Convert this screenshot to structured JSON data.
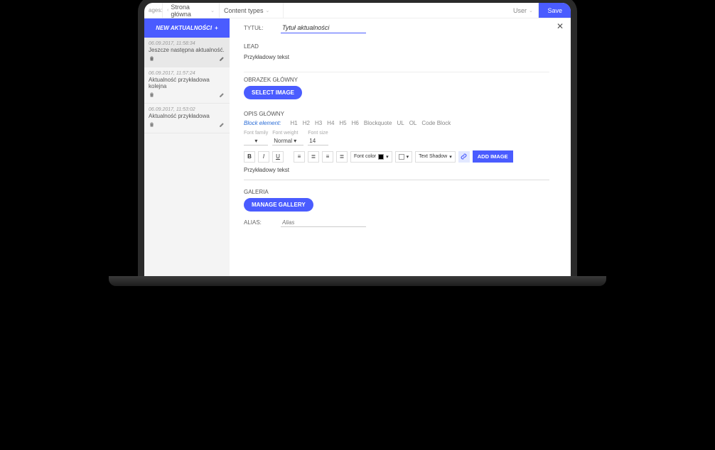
{
  "topbar": {
    "pages_label": "ages:",
    "home_label": "Strona główna",
    "types_label": "Content types",
    "user_label": "User",
    "save_label": "Save"
  },
  "sidebar": {
    "new_button": "NEW AKTUALNOŚCI",
    "items": [
      {
        "date": "06.09.2017, 11:58:34",
        "title": "Jeszcze następna aktualność."
      },
      {
        "date": "06.09.2017, 11:57:24",
        "title": "Aktualność przykładowa kolejna"
      },
      {
        "date": "06.09.2017, 11:53:02",
        "title": "Aktualność przykładowa"
      }
    ]
  },
  "form": {
    "title_label": "TYTUŁ:",
    "title_value": "Tytuł aktualności",
    "lead_label": "LEAD",
    "lead_text": "Przykładowy tekst",
    "main_image_label": "OBRAZEK GŁÓWNY",
    "select_image": "SELECT IMAGE",
    "main_desc_label": "OPIS GŁÓWNY",
    "gallery_label": "GALERIA",
    "manage_gallery": "MANAGE GALLERY",
    "alias_label": "ALIAS:",
    "alias_placeholder": "Alias"
  },
  "editor": {
    "block_element": "Block element:",
    "headings": [
      "H1",
      "H2",
      "H3",
      "H4",
      "H5",
      "H6"
    ],
    "blockquote": "Blockquote",
    "ul": "UL",
    "ol": "OL",
    "code_block": "Code Block",
    "font_family": "Font family",
    "font_weight": "Font weight",
    "font_weight_val": "Normal",
    "font_size": "Font size",
    "font_size_val": "14",
    "font_color": "Font color",
    "text_shadow": "Text Shadow",
    "add_image": "ADD IMAGE",
    "body": "Przykładowy tekst"
  }
}
